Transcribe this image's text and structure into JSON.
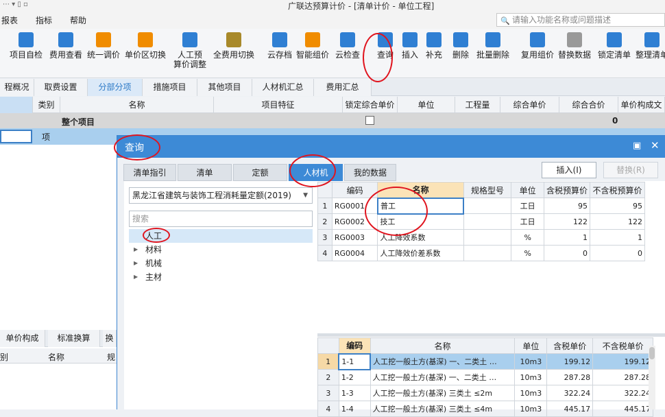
{
  "title": "广联达预算计价 - [清单计价 - 单位工程]",
  "menu": [
    "报表",
    "指标",
    "帮助"
  ],
  "search_placeholder": "请输入功能名称或问题描述",
  "toolbar": [
    {
      "label": "项目自检",
      "icon": "check-doc-icon",
      "color": "#2f7fd3"
    },
    {
      "label": "费用查看",
      "icon": "fee-view-icon",
      "color": "#2f7fd3"
    },
    {
      "label": "统一调价",
      "icon": "price-adjust-icon",
      "color": "#f08c00"
    },
    {
      "label": "单价区切换",
      "icon": "switch-icon",
      "color": "#f08c00"
    },
    {
      "label": "人工预\n算价调整",
      "icon": "labor-icon",
      "color": "#2f7fd3"
    },
    {
      "label": "全费用切换",
      "icon": "full-fee-icon",
      "color": "#a8892a"
    },
    {
      "label": "云存档",
      "icon": "cloud-upload-icon",
      "color": "#2f7fd3"
    },
    {
      "label": "智能组价",
      "icon": "smart-price-icon",
      "color": "#f08c00"
    },
    {
      "label": "云检查",
      "icon": "cloud-check-icon",
      "color": "#2f7fd3"
    },
    {
      "label": "查询",
      "icon": "query-icon",
      "color": "#2f7fd3"
    },
    {
      "label": "插入",
      "icon": "insert-icon",
      "color": "#2f7fd3"
    },
    {
      "label": "补充",
      "icon": "add-icon",
      "color": "#2f7fd3"
    },
    {
      "label": "删除",
      "icon": "trash-icon",
      "color": "#2f7fd3"
    },
    {
      "label": "批量删除",
      "icon": "batch-delete-icon",
      "color": "#2f7fd3"
    },
    {
      "label": "复用组价",
      "icon": "reuse-icon",
      "color": "#2f7fd3"
    },
    {
      "label": "替换数据",
      "icon": "replace-icon",
      "color": "#999999"
    },
    {
      "label": "锁定清单",
      "icon": "lock-icon",
      "color": "#2f7fd3"
    },
    {
      "label": "整理清单",
      "icon": "organize-icon",
      "color": "#2f7fd3"
    }
  ],
  "tabs": [
    "程概况",
    "取费设置",
    "分部分项",
    "措施项目",
    "其他项目",
    "人材机汇总",
    "费用汇总"
  ],
  "grid_headers": [
    "类别",
    "名称",
    "项目特征",
    "锁定综合单价",
    "单位",
    "工程量",
    "综合单价",
    "综合合价",
    "单价构成文"
  ],
  "grid_rows": {
    "row1_name": "整个项目",
    "row1_total": "0",
    "row2_type": "项"
  },
  "dialog": {
    "title": "查询",
    "tabs": [
      "清单指引",
      "清单",
      "定额",
      "人材机",
      "我的数据"
    ],
    "insert_btn": "插入(I)",
    "replace_btn": "替换(R)",
    "library": "黑龙江省建筑与装饰工程消耗量定额(2019)",
    "search_placeholder": "搜索",
    "tree": [
      "人工",
      "材料",
      "机械",
      "主材"
    ],
    "upper_headers": [
      "编码",
      "名称",
      "规格型号",
      "单位",
      "含税预算价",
      "不含税预算价"
    ],
    "upper_rows": [
      {
        "idx": "1",
        "code": "RG0001",
        "name": "普工",
        "spec": "",
        "unit": "工日",
        "tax": "95",
        "notax": "95"
      },
      {
        "idx": "2",
        "code": "RG0002",
        "name": "技工",
        "spec": "",
        "unit": "工日",
        "tax": "122",
        "notax": "122"
      },
      {
        "idx": "3",
        "code": "RG0003",
        "name": "人工降效系数",
        "spec": "",
        "unit": "%",
        "tax": "1",
        "notax": "1"
      },
      {
        "idx": "4",
        "code": "RG0004",
        "name": "人工降效价差系数",
        "spec": "",
        "unit": "%",
        "tax": "0",
        "notax": "0"
      }
    ],
    "lower_headers": [
      "编码",
      "名称",
      "单位",
      "含税单价",
      "不含税单价"
    ],
    "lower_rows": [
      {
        "idx": "1",
        "code": "1-1",
        "name": "人工挖一般土方(基深) 一、二类土 …",
        "unit": "10m3",
        "tax": "199.12",
        "notax": "199.12"
      },
      {
        "idx": "2",
        "code": "1-2",
        "name": "人工挖一般土方(基深) 一、二类土 …",
        "unit": "10m3",
        "tax": "287.28",
        "notax": "287.28"
      },
      {
        "idx": "3",
        "code": "1-3",
        "name": "人工挖一般土方(基深) 三类土 ≤2m",
        "unit": "10m3",
        "tax": "322.24",
        "notax": "322.24"
      },
      {
        "idx": "4",
        "code": "1-4",
        "name": "人工挖一般土方(基深) 三类土 ≤4m",
        "unit": "10m3",
        "tax": "445.17",
        "notax": "445.17"
      }
    ]
  },
  "lower_left": {
    "tabs": [
      "单价构成",
      "标准换算",
      "换"
    ],
    "headers": [
      "别",
      "名称",
      "规"
    ]
  }
}
